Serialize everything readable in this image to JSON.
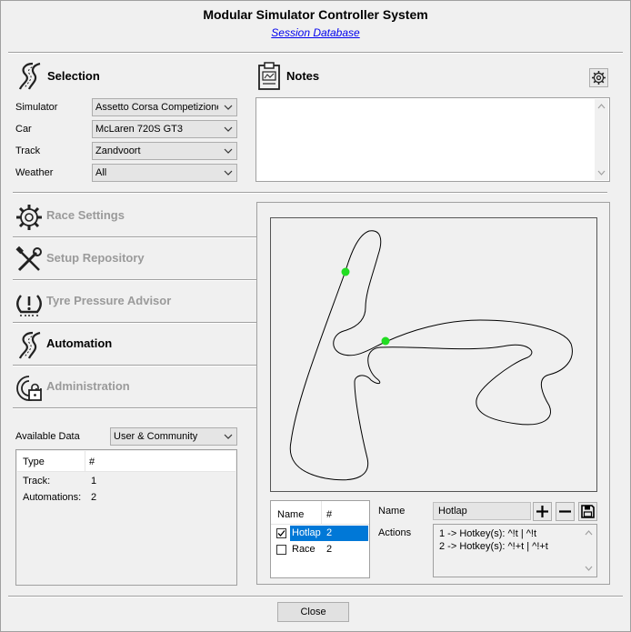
{
  "window": {
    "title": "Modular Simulator Controller System",
    "subtitle_link": "Session Database"
  },
  "selection": {
    "heading": "Selection",
    "fields": [
      {
        "label": "Simulator",
        "value": "Assetto Corsa Competizione"
      },
      {
        "label": "Car",
        "value": "McLaren 720S GT3"
      },
      {
        "label": "Track",
        "value": "Zandvoort"
      },
      {
        "label": "Weather",
        "value": "All"
      }
    ]
  },
  "notes": {
    "heading": "Notes",
    "text": ""
  },
  "nav": {
    "items": [
      {
        "label": "Race Settings",
        "icon": "gear-icon",
        "active": false
      },
      {
        "label": "Setup Repository",
        "icon": "tools-icon",
        "active": false
      },
      {
        "label": "Tyre Pressure Advisor",
        "icon": "tyre-pressure-icon",
        "active": false
      },
      {
        "label": "Automation",
        "icon": "road-icon",
        "active": true
      },
      {
        "label": "Administration",
        "icon": "admin-icon",
        "active": false
      }
    ]
  },
  "available_data": {
    "label": "Available Data",
    "value": "User & Community",
    "columns": [
      "Type",
      "#"
    ],
    "rows": [
      {
        "type": "Track:",
        "count": "1"
      },
      {
        "type": "Automations:",
        "count": "2"
      }
    ]
  },
  "automations": {
    "columns": [
      "Name",
      "#"
    ],
    "rows": [
      {
        "name": "Hotlap",
        "count": "2",
        "checked": true,
        "selected": true
      },
      {
        "name": "Race",
        "count": "2",
        "checked": false,
        "selected": false
      }
    ]
  },
  "automation_detail": {
    "name_label": "Name",
    "name_value": "Hotlap",
    "actions_label": "Actions",
    "actions": [
      "1 -> Hotkey(s): ^!t | ^!t",
      "2 -> Hotkey(s): ^!+t | ^!+t"
    ]
  },
  "colors": {
    "marker": "#22dd22",
    "selection": "#0078d7",
    "link": "#0000ee"
  },
  "footer": {
    "close_label": "Close"
  }
}
